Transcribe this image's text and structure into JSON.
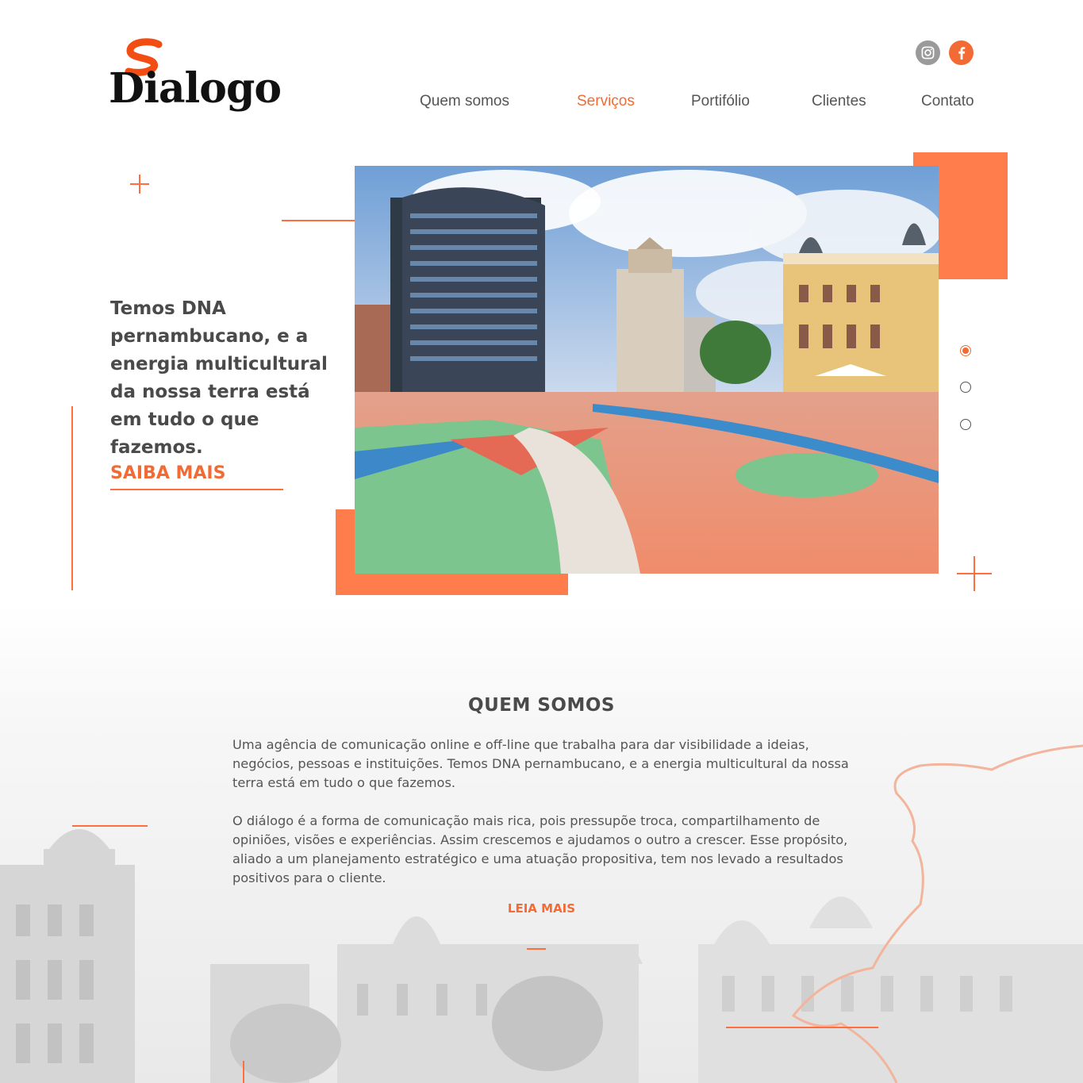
{
  "brand": {
    "name": "Dialogo",
    "accent": "#f26b35",
    "orange_block": "#ff7c4c"
  },
  "social": [
    {
      "name": "instagram-icon",
      "color": "#9a9a9a"
    },
    {
      "name": "facebook-icon",
      "color": "#f26b35",
      "glyph": "f"
    }
  ],
  "nav": {
    "items": [
      {
        "label": "Quem somos",
        "active": false
      },
      {
        "label": "Serviços",
        "active": true
      },
      {
        "label": "Portifólio",
        "active": false
      },
      {
        "label": "Clientes",
        "active": false
      },
      {
        "label": "Contato",
        "active": false
      }
    ]
  },
  "hero": {
    "headline": "Temos DNA pernambucano, e a energia multicultural da nossa terra está em tudo o que fazemos.",
    "cta": "SAIBA MAIS",
    "slider": {
      "count": 3,
      "active_index": 0
    }
  },
  "about": {
    "title": "QUEM SOMOS",
    "paragraph1": "Uma agência de comunicação online e off-line que trabalha para dar visibilidade a ideias, negócios, pessoas e instituições. Temos DNA pernambucano, e a energia multicultural da nossa terra está em tudo o que fazemos.",
    "paragraph2": "O diálogo é a forma de comunicação mais rica, pois pressupõe troca, compartilhamento de opiniões, visões e experiências. Assim crescemos e ajudamos o outro a crescer. Esse propósito, aliado a um planejamento estratégico e uma atuação propositiva, tem nos levado a resultados positivos para o cliente.",
    "cta": "LEIA MAIS"
  }
}
